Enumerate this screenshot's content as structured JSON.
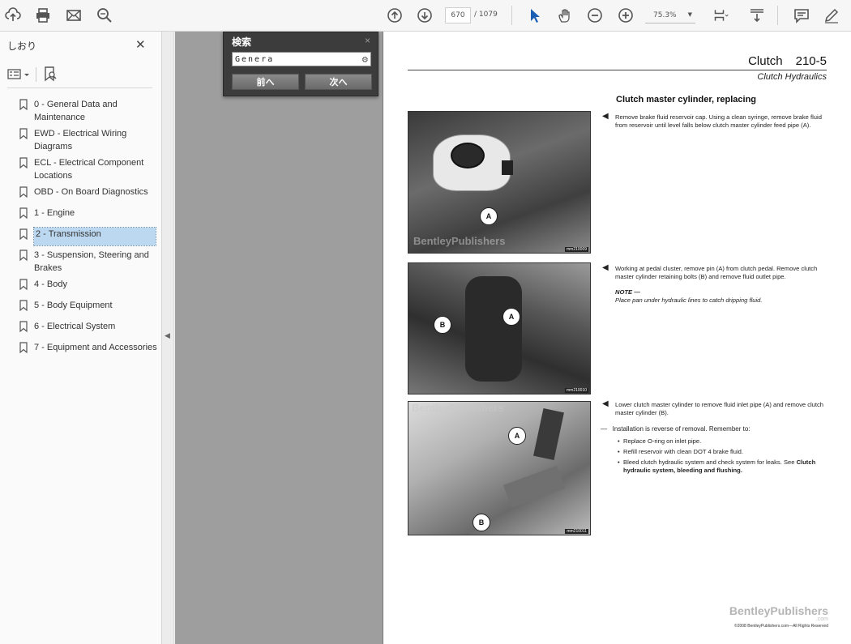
{
  "toolbar": {
    "page_current": "670",
    "page_total": "/ 1079",
    "zoom": "75.3%"
  },
  "sidebar": {
    "title": "しおり",
    "close": "✕",
    "items": [
      {
        "label": "0 - General Data and Maintenance"
      },
      {
        "label": "EWD - Electrical Wiring Diagrams"
      },
      {
        "label": "ECL - Electrical Component Locations"
      },
      {
        "label": "OBD - On Board Diagnostics"
      },
      {
        "label": "1 - Engine"
      },
      {
        "label": "2 - Transmission"
      },
      {
        "label": "3 - Suspension, Steering and Brakes"
      },
      {
        "label": "4 - Body"
      },
      {
        "label": "5 - Body Equipment"
      },
      {
        "label": "6 - Electrical System"
      },
      {
        "label": "7 - Equipment and Accessories"
      }
    ]
  },
  "search": {
    "title": "検索",
    "close": "×",
    "value": "Genera",
    "prev": "前へ",
    "next": "次へ"
  },
  "page": {
    "chapter": "Clutch",
    "number": "210-5",
    "subtitle": "Clutch Hydraulics",
    "section_heading": "Clutch master cylinder, replacing",
    "step1": "Remove brake fluid reservoir cap. Using a clean syringe, remove brake fluid from reservoir until level falls below clutch master cylinder feed pipe (A).",
    "step2": "Working at pedal cluster, remove pin (A) from clutch pedal. Remove clutch master cylinder retaining bolts (B) and remove fluid outlet pipe.",
    "note_head": "NOTE —",
    "note_body": "Place pan under hydraulic lines to catch dripping fluid.",
    "step3": "Lower clutch master cylinder to remove fluid inlet pipe (A) and remove clutch master cylinder (B).",
    "dash_text": "Installation is reverse of removal. Remember to:",
    "bullets": {
      "b1": "Replace O-ring on inlet pipe.",
      "b2": "Refill reservoir with clean DOT 4 brake fluid.",
      "b3a": "Bleed clutch hydraulic system and check system for leaks. See ",
      "b3b": "Clutch hydraulic system, bleeding and flushing."
    },
    "photo_tags": {
      "p1": "mm210009",
      "p2": "mm210010",
      "p3": "mm210011"
    },
    "watermark": "BentleyPublishers",
    "callouts": {
      "a": "A",
      "b": "B"
    },
    "brand": "BentleyPublishers",
    "brand_com": ".com",
    "copyright": "©2008 BentleyPublishers.com—All Rights Reserved"
  }
}
